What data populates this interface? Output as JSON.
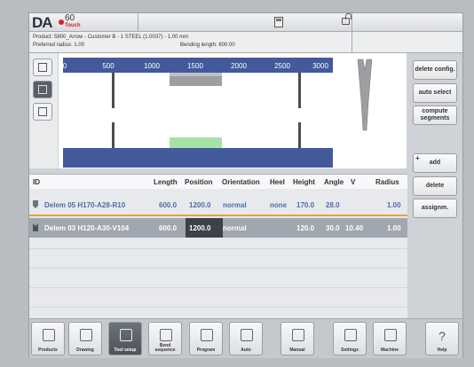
{
  "header": {
    "logo_text": "DA",
    "model": "60",
    "edition": "Touch",
    "calculator_icon": "calculator-icon",
    "lock_icon": "lock-icon"
  },
  "info": {
    "product_line": "Product: 5800_Arrow - Customer B - 1 STEEL (1.0037) - 1.00 mm",
    "radius_line": "Preferred radius: 1.00",
    "bending_length": "Bending length: 600.00"
  },
  "ruler": {
    "ticks": [
      "0",
      "500",
      "1000",
      "1500",
      "2000",
      "2500",
      "3000"
    ]
  },
  "side_buttons": {
    "delete_config": "delete config.",
    "auto_select": "auto select",
    "compute_segments": "compute segments",
    "add": "add",
    "add_prefix": "+",
    "delete": "delete",
    "assign": "assignm."
  },
  "table": {
    "columns": [
      "ID",
      "Length",
      "Position",
      "Orientation",
      "Heel",
      "Height",
      "Angle",
      "V",
      "Radius"
    ],
    "rows": [
      {
        "id": "Delem 05 H170-A28-R10",
        "length": "600.0",
        "position": "1200.0",
        "orientation": "normal",
        "heel": "none",
        "height": "170.0",
        "angle": "28.0",
        "v": "",
        "radius": "1.00"
      },
      {
        "id": "Delem 03 H120-A30-V104",
        "length": "600.0",
        "position": "1200.0",
        "orientation": "normal",
        "heel": "",
        "height": "120.0",
        "angle": "30.0",
        "v": "10.40",
        "radius": "1.00"
      }
    ]
  },
  "nav": [
    {
      "label": "Products",
      "icon": "folder-icon"
    },
    {
      "label": "Drawing",
      "icon": "drawing-icon"
    },
    {
      "label": "Tool setup",
      "icon": "tool-setup-icon"
    },
    {
      "label": "Bend sequence",
      "icon": "bend-sequence-icon"
    },
    {
      "label": "Program",
      "icon": "program-icon"
    },
    {
      "label": "Auto",
      "icon": "play-icon"
    },
    {
      "label": "Manual",
      "icon": "hand-icon"
    },
    {
      "label": "Settings",
      "icon": "settings-icon"
    },
    {
      "label": "Machine",
      "icon": "machine-icon"
    },
    {
      "label": "Help",
      "icon": "help-icon",
      "glyph": "?"
    }
  ],
  "colors": {
    "accent_blue": "#425a9b",
    "selection_orange": "#e6a13a",
    "die_green": "#a6e2a6"
  }
}
